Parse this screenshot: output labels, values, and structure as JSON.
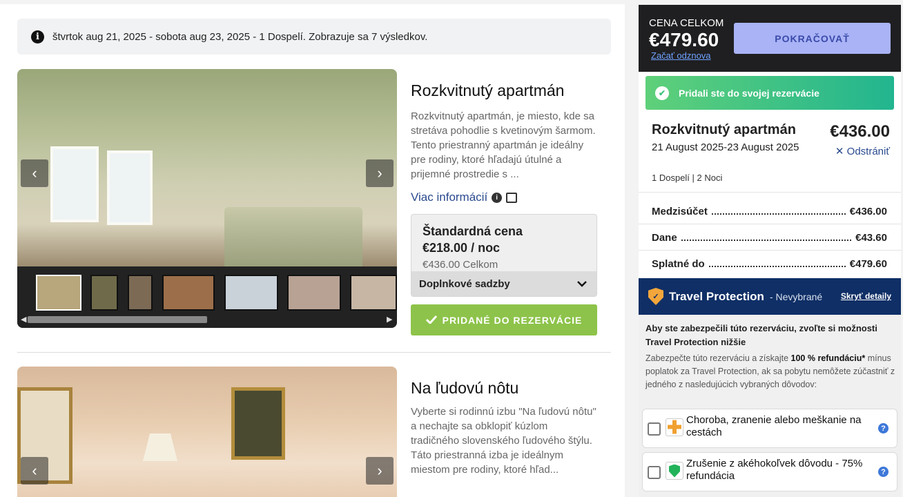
{
  "search_summary": "štvrtok aug 21, 2025 - sobota aug 23, 2025 - 1 Dospelí. Zobrazuje sa 7 výsledkov.",
  "rooms": [
    {
      "title": "Rozkvitnutý apartmán",
      "description": "Rozkvitnutý apartmán, je miesto, kde sa stretáva pohodlie s kvetinovým šarmom. Tento priestranný apartmán je ideálny pre rodiny, ktoré hľadajú útulné a prijemné prostredie s ...",
      "more_info": "Viac informácií",
      "rate_name": "Štandardná cena",
      "rate_per_night": "€218.00 / noc",
      "rate_total": "€436.00 Celkom",
      "extra_rates": "Doplnkové sadzby",
      "added_label": "PRIDANÉ DO REZERVÁCIE"
    },
    {
      "title": "Na ľudovú nôtu",
      "description": "Vyberte si rodinnú izbu \"Na ľudovú nôtu\" a nechajte sa obklopiť kúzlom tradičného slovenského ľudového štýlu. Táto priestranná izba je ideálnym miestom pre rodiny, ktoré hľad..."
    }
  ],
  "sidebar": {
    "total_label": "CENA CELKOM",
    "total_amount": "€479.60",
    "restart_link": "Začať odznova",
    "continue_label": "POKRAČOVAŤ",
    "success_message": "Pridali ste do svojej rezervácie",
    "booked_room": {
      "title": "Rozkvitnutý apartmán",
      "dates": "21 August 2025-23 August 2025",
      "guests": "1 Dospelí | 2 Noci",
      "price": "€436.00",
      "remove_label": "Odstrániť"
    },
    "summary": [
      {
        "label": "Medzisúčet",
        "value": "€436.00"
      },
      {
        "label": "Dane",
        "value": "€43.60"
      },
      {
        "label": "Splatné do",
        "value": "€479.60"
      }
    ],
    "travel_protection": {
      "title": "Travel Protection",
      "status": "- Nevybrané",
      "hide_link": "Skryť detaily",
      "lead": "Aby ste zabezpečili túto rezerváciu, zvoľte si možnosti Travel Protection nižšie",
      "desc_start": "Zabezpečte túto rezerváciu a získajte ",
      "desc_bold": "100 % refundáciu*",
      "desc_end": " mínus poplatok za Travel Protection, ak sa pobytu nemôžete zúčastniť z jedného z nasledujúcich vybraných dôvodov:",
      "options": [
        {
          "label": "Choroba, zranenie alebo meškanie na cestách"
        },
        {
          "label": "Zrušenie z akéhokoľvek dôvodu - 75% refundácia"
        }
      ]
    }
  }
}
